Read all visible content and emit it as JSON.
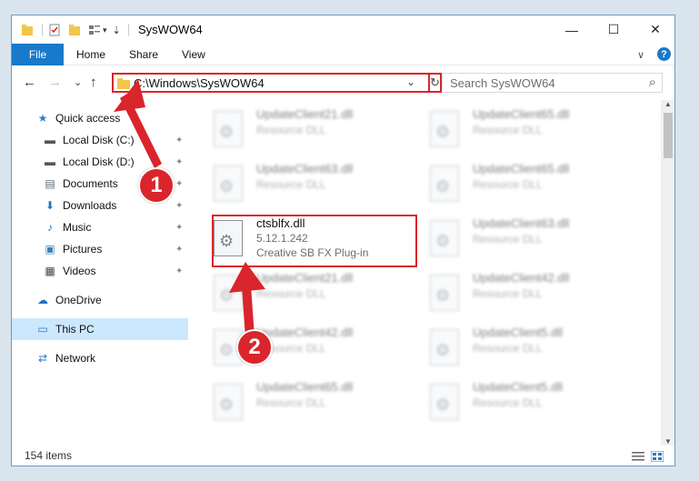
{
  "window": {
    "title": "SysWOW64",
    "minimize": "—",
    "maximize": "☐",
    "close": "✕"
  },
  "ribbon": {
    "tabs": [
      "File",
      "Home",
      "Share",
      "View"
    ],
    "collapse": "∨",
    "help": "?"
  },
  "nav": {
    "back": "←",
    "forward": "→",
    "recent": "⌄",
    "up": "↑",
    "address": "C:\\Windows\\SysWOW64",
    "dropdown": "⌄",
    "refresh": "↻",
    "search_placeholder": "Search SysWOW64",
    "search_icon": "⌕"
  },
  "sidebar": {
    "items": [
      {
        "label": "Quick access",
        "icon": "star-icon",
        "glyph": "★",
        "color": "#2f7fd0"
      },
      {
        "label": "Local Disk (C:)",
        "icon": "drive-icon",
        "glyph": "▬",
        "color": "#555"
      },
      {
        "label": "Local Disk (D:)",
        "icon": "drive-icon",
        "glyph": "▬",
        "color": "#555"
      },
      {
        "label": "Documents",
        "icon": "documents-icon",
        "glyph": "▤",
        "color": "#5b6b78"
      },
      {
        "label": "Downloads",
        "icon": "downloads-icon",
        "glyph": "⬇",
        "color": "#1f72c6"
      },
      {
        "label": "Music",
        "icon": "music-icon",
        "glyph": "♪",
        "color": "#1f72c6"
      },
      {
        "label": "Pictures",
        "icon": "pictures-icon",
        "glyph": "▣",
        "color": "#3a7fb8"
      },
      {
        "label": "Videos",
        "icon": "videos-icon",
        "glyph": "▦",
        "color": "#444"
      },
      {
        "label": "OneDrive",
        "icon": "onedrive-icon",
        "glyph": "☁",
        "color": "#1f72c6"
      },
      {
        "label": "This PC",
        "icon": "this-pc-icon",
        "glyph": "▭",
        "color": "#2b79c2"
      },
      {
        "label": "Network",
        "icon": "network-icon",
        "glyph": "⇄",
        "color": "#2b79c2"
      }
    ],
    "pin": "📌"
  },
  "files": {
    "blurred": [
      {
        "name": "UpdateClient21.dll",
        "desc": "Resource DLL"
      },
      {
        "name": "UpdateClient65.dll",
        "desc": "Resource DLL"
      },
      {
        "name": "UpdateClient63.dll",
        "desc": "Resource DLL"
      },
      {
        "name": "UpdateClient65.dll",
        "desc": "Resource DLL"
      },
      {
        "name": "UpdateClient63.dll",
        "desc": "Resource DLL"
      },
      {
        "name": "UpdateClient21.dll",
        "desc": "Resource DLL"
      },
      {
        "name": "UpdateClient42.dll",
        "desc": "Resource DLL"
      },
      {
        "name": "UpdateClient42.dll",
        "desc": "Resource DLL"
      },
      {
        "name": "UpdateClient5.dll",
        "desc": "Resource DLL"
      },
      {
        "name": "UpdateClient65.dll",
        "desc": "Resource DLL"
      },
      {
        "name": "UpdateClient5.dll",
        "desc": "Resource DLL"
      }
    ],
    "highlighted": {
      "name": "ctsblfx.dll",
      "version": "5.12.1.242",
      "desc": "Creative SB FX Plug-in"
    }
  },
  "status": {
    "count": "154 items"
  },
  "annotations": {
    "step1": "1",
    "step2": "2",
    "color": "#d9252b"
  }
}
